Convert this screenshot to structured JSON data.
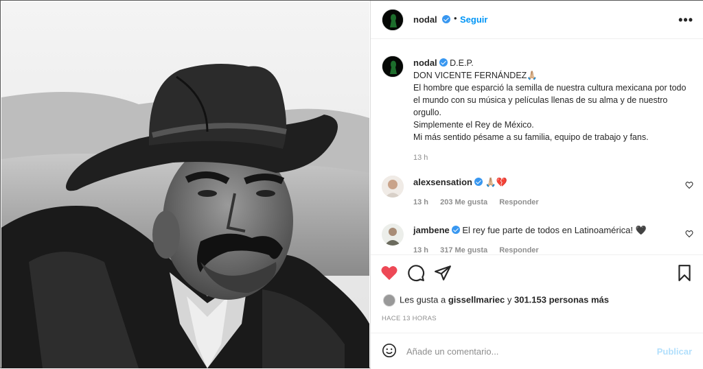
{
  "header": {
    "username": "nodal",
    "dot": "•",
    "follow_label": "Seguir",
    "more_label": "•••"
  },
  "caption": {
    "username": "nodal",
    "lines": [
      "D.E.P.",
      "DON VICENTE FERNÁNDEZ🙏🏼",
      "El hombre que esparció la semilla de nuestra cultura mexicana por todo el mundo con su música y películas llenas de su alma y de nuestro orgullo.",
      "Simplemente el Rey de México.",
      "Mi más sentido pésame a su familia, equipo de trabajo y fans."
    ],
    "time": "13 h"
  },
  "comments": [
    {
      "username": "alexsensation",
      "text": "🙏🏼💔",
      "time": "13 h",
      "likes": "203 Me gusta",
      "reply": "Responder"
    },
    {
      "username": "jambene",
      "text": "El rey fue parte de todos en Latinoamérica! 🖤",
      "time": "13 h",
      "likes": "317 Me gusta",
      "reply": "Responder"
    }
  ],
  "likes": {
    "prefix": "Les gusta a",
    "user": "gissellmariec",
    "connector": "y",
    "count": "301.153 personas más"
  },
  "posted_ago": "HACE 13 HORAS",
  "add_comment": {
    "placeholder": "Añade un comentario...",
    "post_label": "Publicar"
  },
  "colors": {
    "accent": "#0095f6",
    "like_red": "#ed4956",
    "verified": "#3897f0",
    "post_disabled": "#b2dffc"
  }
}
